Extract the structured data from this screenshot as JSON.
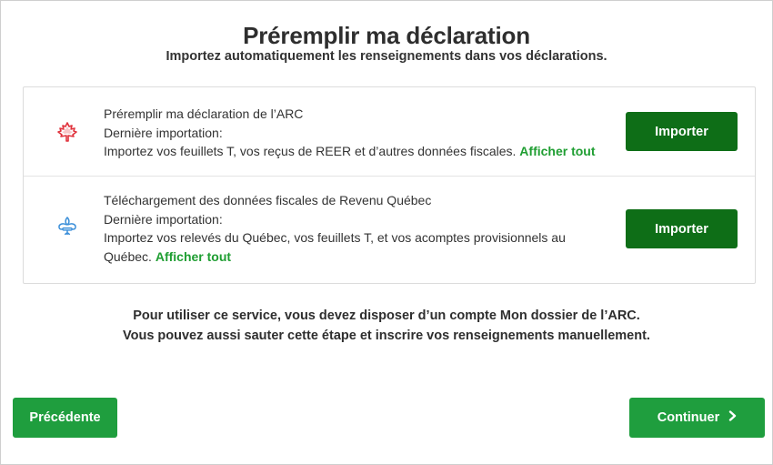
{
  "header": {
    "title": "Préremplir ma déclaration",
    "subtitle": "Importez automatiquement les renseignements dans vos déclarations."
  },
  "imports": [
    {
      "icon": "maple-leaf-icon",
      "icon_color": "#e0323c",
      "title": "Préremplir ma déclaration de l’ARC",
      "last_import": "Dernière importation:",
      "description": "Importez vos feuillets T, vos reçus de REER et d’autres données fiscales.",
      "show_all": "Afficher tout",
      "button": "Importer"
    },
    {
      "icon": "fleur-de-lis-icon",
      "icon_color": "#3b8fd9",
      "title": "Téléchargement des données fiscales de Revenu Québec",
      "last_import": "Dernière importation:",
      "description": "Importez vos relevés du Québec, vos feuillets T, et vos acomptes provisionnels au Québec.",
      "show_all": "Afficher tout",
      "button": "Importer"
    }
  ],
  "info": {
    "line1_prefix": "Pour utiliser ce service, vous devez disposer d’un compte",
    "line1_bold": "Mon dossier de l’ARC",
    "line1_suffix": ".",
    "line2": "Vous pouvez aussi sauter cette étape et inscrire vos renseignements manuellement."
  },
  "footer": {
    "prev_label": "Précédente",
    "next_label": "Continuer",
    "next_icon": "chevron-right-icon"
  },
  "colors": {
    "import_button": "#0e6e17",
    "nav_button": "#1f9e3e",
    "link": "#1f9e32"
  }
}
